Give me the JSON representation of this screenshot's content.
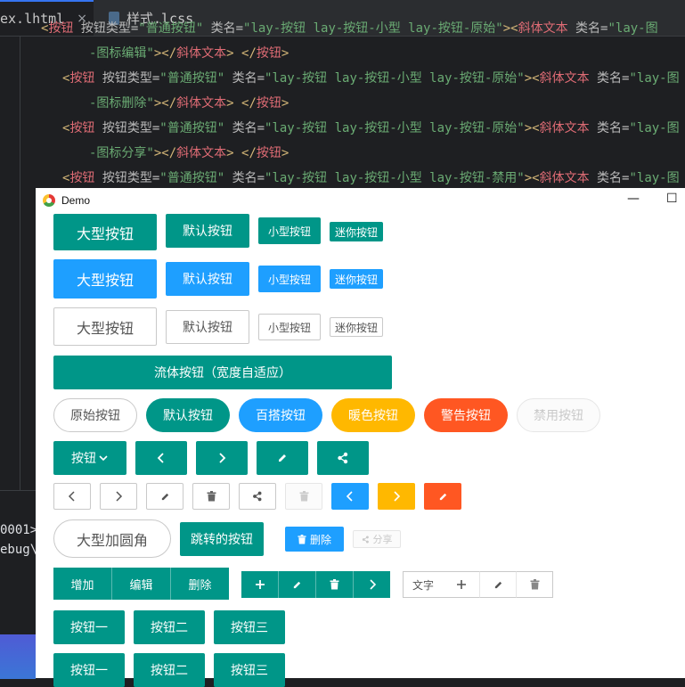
{
  "editor": {
    "tabs": [
      {
        "label": "ex.lhtml",
        "close": "×"
      },
      {
        "label": "样式.lcss"
      }
    ],
    "lines": [
      {
        "indent": "  ",
        "parts": [
          [
            "c-br",
            "<"
          ],
          [
            "c-tag",
            "按钮"
          ],
          [
            "c-attr",
            " 按钮类型="
          ],
          [
            "c-str",
            "\"普通按钮\""
          ],
          [
            "c-attr",
            " 类名="
          ],
          [
            "c-str",
            "\"lay-按钮 lay-按钮-小型 lay-按钮-原始\""
          ],
          [
            "c-br",
            ">"
          ],
          [
            "c-br",
            "<"
          ],
          [
            "c-tag",
            "斜体文本"
          ],
          [
            "c-attr",
            " 类名="
          ],
          [
            "c-str",
            "\"lay-图"
          ]
        ]
      },
      {
        "indent": "      ",
        "parts": [
          [
            "c-str",
            "-图标编辑\""
          ],
          [
            "c-br",
            ">"
          ],
          [
            "c-br",
            "</"
          ],
          [
            "c-tag",
            "斜体文本"
          ],
          [
            "c-br",
            "> </"
          ],
          [
            "c-tag",
            "按钮"
          ],
          [
            "c-br",
            ">"
          ]
        ]
      },
      {
        "indent": "    ",
        "parts": [
          [
            "c-br",
            "<"
          ],
          [
            "c-tag",
            "按钮"
          ],
          [
            "c-attr",
            " 按钮类型="
          ],
          [
            "c-str",
            "\"普通按钮\""
          ],
          [
            "c-attr",
            " 类名="
          ],
          [
            "c-str",
            "\"lay-按钮 lay-按钮-小型 lay-按钮-原始\""
          ],
          [
            "c-br",
            ">"
          ],
          [
            "c-br",
            "<"
          ],
          [
            "c-tag",
            "斜体文本"
          ],
          [
            "c-attr",
            " 类名="
          ],
          [
            "c-str",
            "\"lay-图"
          ]
        ]
      },
      {
        "indent": "      ",
        "parts": [
          [
            "c-str",
            "-图标删除\""
          ],
          [
            "c-br",
            ">"
          ],
          [
            "c-br",
            "</"
          ],
          [
            "c-tag",
            "斜体文本"
          ],
          [
            "c-br",
            "> </"
          ],
          [
            "c-tag",
            "按钮"
          ],
          [
            "c-br",
            ">"
          ]
        ]
      },
      {
        "indent": "    ",
        "parts": [
          [
            "c-br",
            "<"
          ],
          [
            "c-tag",
            "按钮"
          ],
          [
            "c-attr",
            " 按钮类型="
          ],
          [
            "c-str",
            "\"普通按钮\""
          ],
          [
            "c-attr",
            " 类名="
          ],
          [
            "c-str",
            "\"lay-按钮 lay-按钮-小型 lay-按钮-原始\""
          ],
          [
            "c-br",
            ">"
          ],
          [
            "c-br",
            "<"
          ],
          [
            "c-tag",
            "斜体文本"
          ],
          [
            "c-attr",
            " 类名="
          ],
          [
            "c-str",
            "\"lay-图"
          ]
        ]
      },
      {
        "indent": "      ",
        "parts": [
          [
            "c-str",
            "-图标分享\""
          ],
          [
            "c-br",
            ">"
          ],
          [
            "c-br",
            "</"
          ],
          [
            "c-tag",
            "斜体文本"
          ],
          [
            "c-br",
            "> </"
          ],
          [
            "c-tag",
            "按钮"
          ],
          [
            "c-br",
            ">"
          ]
        ]
      },
      {
        "indent": "    ",
        "parts": [
          [
            "c-br",
            "<"
          ],
          [
            "c-tag",
            "按钮"
          ],
          [
            "c-attr",
            " 按钮类型="
          ],
          [
            "c-str",
            "\"普通按钮\""
          ],
          [
            "c-attr",
            " 类名="
          ],
          [
            "c-str",
            "\"lay-按钮 lay-按钮-小型 lay-按钮-禁用\""
          ],
          [
            "c-br",
            ">"
          ],
          [
            "c-br",
            "<"
          ],
          [
            "c-tag",
            "斜体文本"
          ],
          [
            "c-attr",
            " 类名="
          ],
          [
            "c-str",
            "\"lay-图"
          ]
        ]
      }
    ],
    "console": [
      "0001>",
      "ebug\\"
    ]
  },
  "window": {
    "title": "Demo",
    "minimize": "—",
    "maximize": "☐"
  },
  "buttons": {
    "row1": [
      "大型按钮",
      "默认按钮",
      "小型按钮",
      "迷你按钮"
    ],
    "row2": [
      "大型按钮",
      "默认按钮",
      "小型按钮",
      "迷你按钮"
    ],
    "row3": [
      "大型按钮",
      "默认按钮",
      "小型按钮",
      "迷你按钮"
    ],
    "fluid": "流体按钮（宽度自适应）",
    "round": [
      "原始按钮",
      "默认按钮",
      "百搭按钮",
      "暖色按钮",
      "警告按钮",
      "禁用按钮"
    ],
    "dropdown": "按钮",
    "big_round": "大型加圆角",
    "jump": "跳转的按钮",
    "delete": "删除",
    "share": "分享",
    "group1": [
      "增加",
      "编辑",
      "删除"
    ],
    "text_btn": "文字",
    "row_a": [
      "按钮一",
      "按钮二",
      "按钮三"
    ],
    "row_b": [
      "按钮一",
      "按钮二",
      "按钮三"
    ]
  },
  "colors": {
    "green": "#009688",
    "blue": "#1e9fff",
    "orange": "#ffb800",
    "red": "#ff5722"
  }
}
